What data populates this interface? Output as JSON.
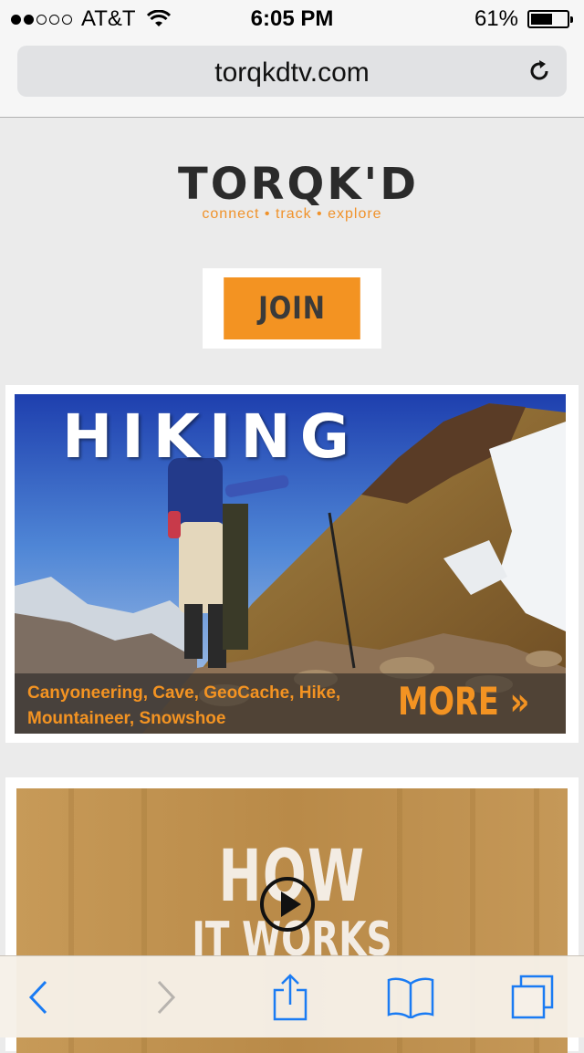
{
  "status_bar": {
    "carrier": "AT&T",
    "time": "6:05 PM",
    "battery": "61%",
    "battery_level": 0.61,
    "signal_bars_filled": 2,
    "signal_bars_total": 5
  },
  "address_bar": {
    "url": "torqkdtv.com"
  },
  "logo": {
    "name": "TORQK'D",
    "tagline": "connect • track • explore"
  },
  "join_button": {
    "label": "JOIN"
  },
  "hiking_card": {
    "title": "HIKING",
    "activities": "Canyoneering, Cave, GeoCache, Hike, Mountaineer, Snowshoe",
    "more_label": "MORE »"
  },
  "video_card": {
    "line1": "HOW",
    "line2": "IT WORKS"
  },
  "toolbar": {
    "icons": [
      "back-icon",
      "forward-icon",
      "share-icon",
      "bookmarks-icon",
      "tabs-icon"
    ]
  },
  "colors": {
    "accent_orange": "#f39322",
    "ios_blue": "#1a7bf3",
    "page_bg": "#ebebeb"
  }
}
